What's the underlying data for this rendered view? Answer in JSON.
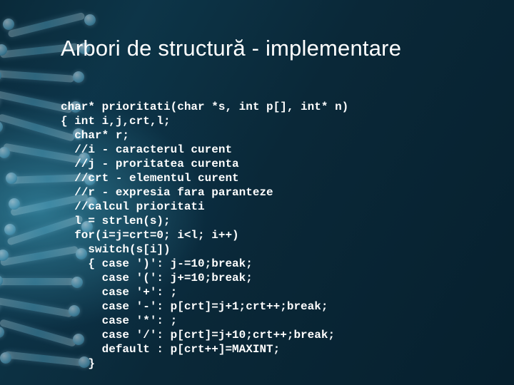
{
  "title": "Arbori de structură - implementare",
  "code": "char* prioritati(char *s, int p[], int* n)\n{ int i,j,crt,l;\n  char* r;\n  //i - caracterul curent\n  //j - proritatea curenta\n  //crt - elementul curent\n  //r - expresia fara paranteze\n  //calcul prioritati\n  l = strlen(s);\n  for(i=j=crt=0; i<l; i++)\n    switch(s[i])\n    { case ')': j-=10;break;\n      case '(': j+=10;break;\n      case '+': ;\n      case '-': p[crt]=j+1;crt++;break;\n      case '*': ;\n      case '/': p[crt]=j+10;crt++;break;\n      default : p[crt++]=MAXINT;\n    }"
}
